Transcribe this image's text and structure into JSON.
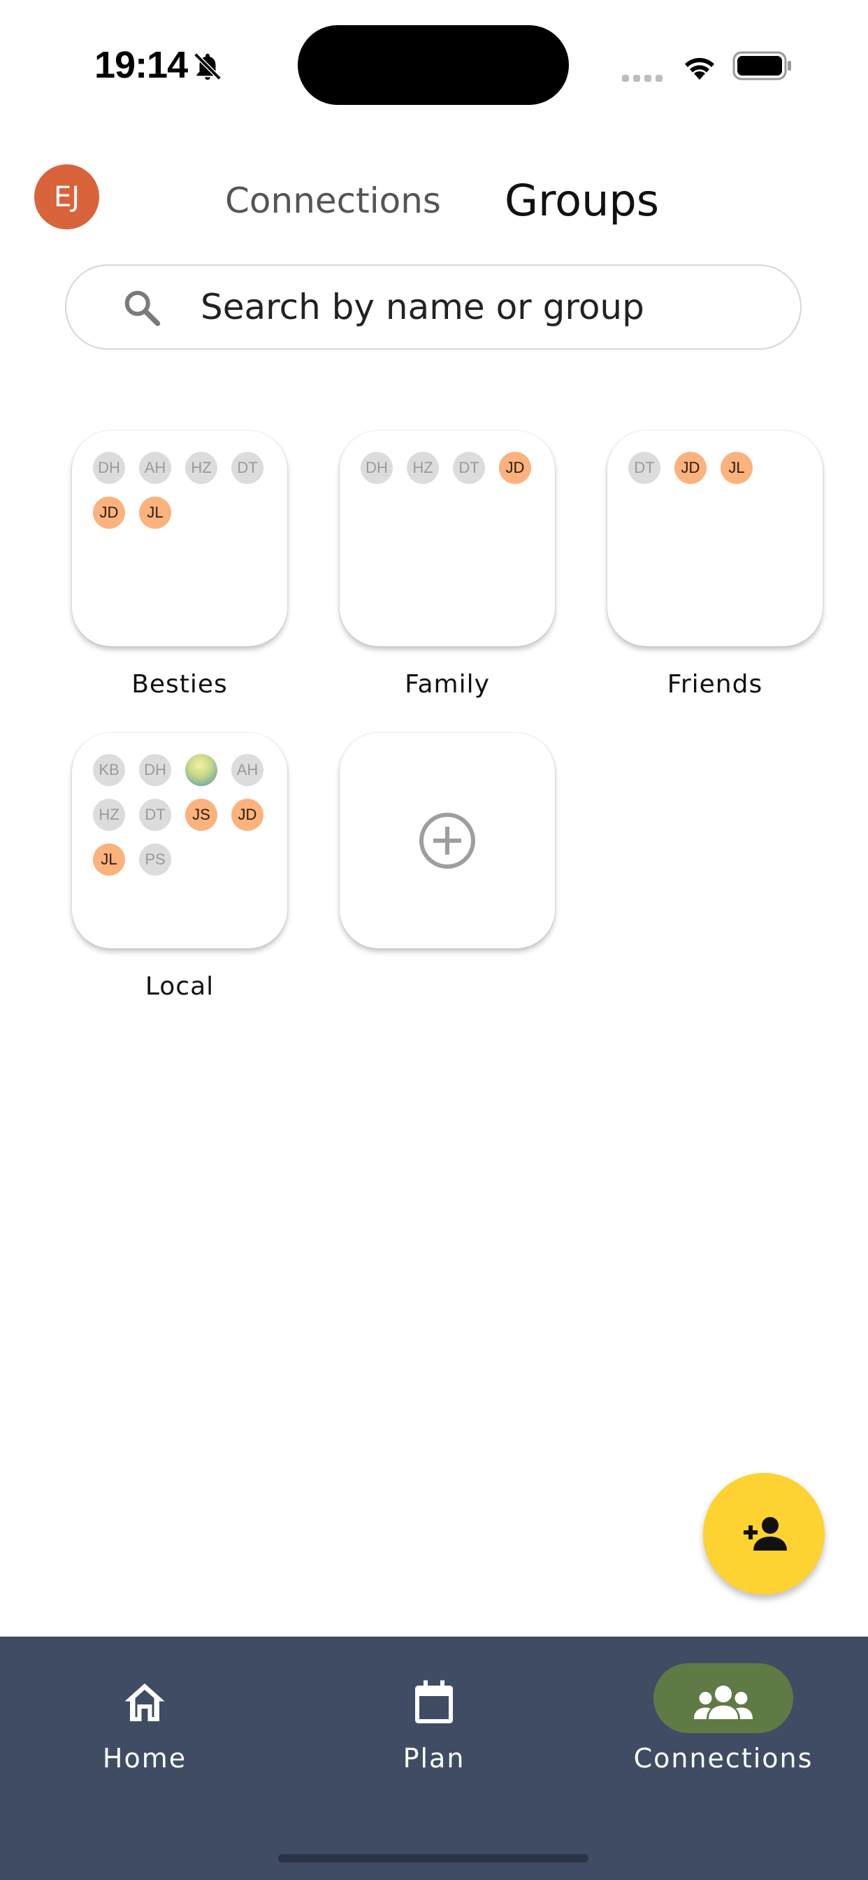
{
  "status_bar": {
    "time": "19:14",
    "icons": [
      "bell-slash-icon",
      "cellular-signal-icon",
      "wifi-icon",
      "battery-icon"
    ]
  },
  "header": {
    "avatar_initials": "EJ",
    "avatar_color": "#d9633a",
    "tabs": [
      {
        "label": "Connections",
        "active": false
      },
      {
        "label": "Groups",
        "active": true
      }
    ]
  },
  "search": {
    "placeholder": "Search by name or group"
  },
  "groups": [
    {
      "name": "Besties",
      "members": [
        {
          "initials": "DH",
          "style": "grey"
        },
        {
          "initials": "AH",
          "style": "grey"
        },
        {
          "initials": "HZ",
          "style": "grey"
        },
        {
          "initials": "DT",
          "style": "grey"
        },
        {
          "initials": "JD",
          "style": "orange"
        },
        {
          "initials": "JL",
          "style": "orange"
        }
      ]
    },
    {
      "name": "Family",
      "members": [
        {
          "initials": "DH",
          "style": "grey"
        },
        {
          "initials": "HZ",
          "style": "grey"
        },
        {
          "initials": "DT",
          "style": "grey"
        },
        {
          "initials": "JD",
          "style": "orange"
        }
      ]
    },
    {
      "name": "Friends",
      "members": [
        {
          "initials": "DT",
          "style": "grey"
        },
        {
          "initials": "JD",
          "style": "orange"
        },
        {
          "initials": "JL",
          "style": "orange"
        }
      ]
    },
    {
      "name": "Local",
      "members": [
        {
          "initials": "KB",
          "style": "grey"
        },
        {
          "initials": "DH",
          "style": "grey"
        },
        {
          "initials": "",
          "style": "photo"
        },
        {
          "initials": "AH",
          "style": "grey"
        },
        {
          "initials": "HZ",
          "style": "grey"
        },
        {
          "initials": "DT",
          "style": "grey"
        },
        {
          "initials": "JS",
          "style": "orange"
        },
        {
          "initials": "JD",
          "style": "orange"
        },
        {
          "initials": "JL",
          "style": "orange"
        },
        {
          "initials": "PS",
          "style": "grey"
        }
      ]
    }
  ],
  "add_group_icon": "plus-circle-icon",
  "fab": {
    "icon": "add-person-icon",
    "color": "#fdd231"
  },
  "bottom_nav": {
    "background": "#3f4c64",
    "items": [
      {
        "label": "Home",
        "icon": "home-icon",
        "active": false
      },
      {
        "label": "Plan",
        "icon": "calendar-icon",
        "active": false
      },
      {
        "label": "Connections",
        "icon": "people-icon",
        "active": true
      }
    ],
    "active_pill_color": "#5f7a45"
  }
}
